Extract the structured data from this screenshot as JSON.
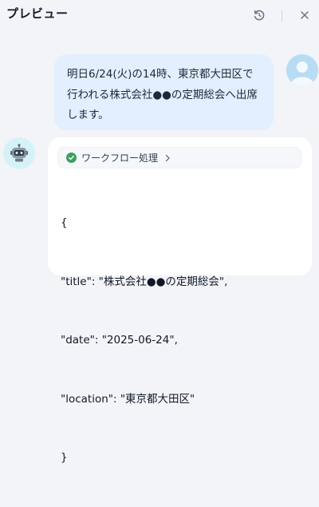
{
  "header": {
    "title": "プレビュー"
  },
  "conversation": {
    "user_message": "明日6/24(火)の14時、東京都大田区で行われる株式会社●●の定期総会へ出席します。",
    "bot_reply": {
      "workflow_label": "ワークフロー処理",
      "json_lines": [
        "{",
        "\"title\": \"株式会社●●の定期総会\",",
        "\"date\": \"2025-06-24\",",
        "\"location\": \"東京都大田区\"",
        "}"
      ]
    }
  },
  "icons": {
    "refresh": "refresh-icon",
    "close": "close-icon",
    "user_avatar": "user-avatar-icon",
    "bot_avatar": "robot-icon",
    "check": "check-circle-icon",
    "chevron": "chevron-right-icon"
  },
  "colors": {
    "background": "#f2f4f7",
    "user_bubble": "#e1effe",
    "bot_card": "#ffffff",
    "success_check": "#3f9e5e"
  }
}
